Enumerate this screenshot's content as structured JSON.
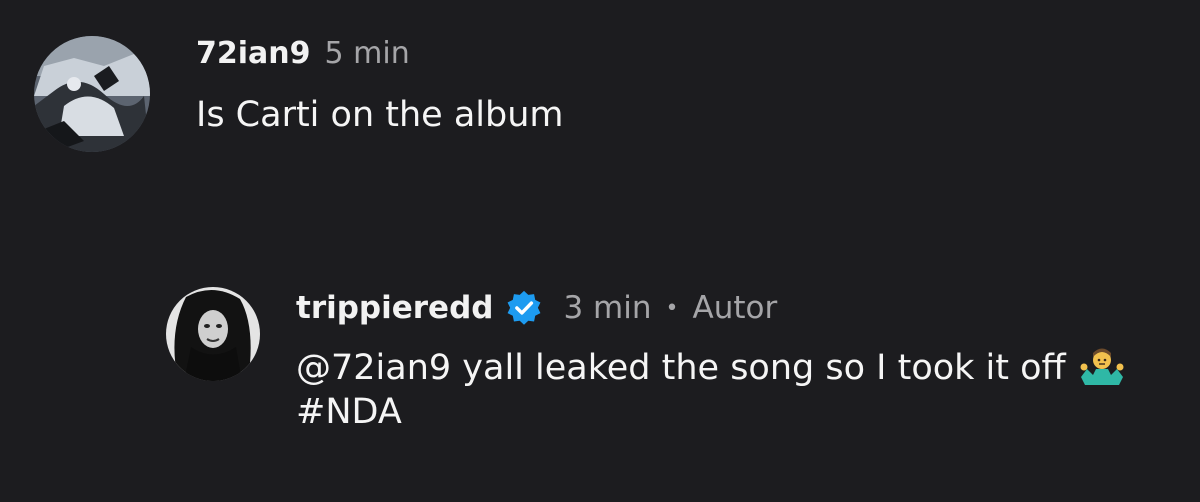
{
  "comments": [
    {
      "username": "72ian9",
      "time": "5 min",
      "text": "Is Carti on the album"
    },
    {
      "username": "trippieredd",
      "verified": true,
      "time": "3 min",
      "separator": "•",
      "author_tag": "Autor",
      "mention": "@72ian9",
      "text_line": " yall leaked the song so I took it off",
      "emoji": "person-shrugging",
      "hashtag": "#NDA"
    }
  ],
  "colors": {
    "background": "#1c1c1f",
    "primary_text": "#f5f5f5",
    "secondary_text": "#a5a5a8",
    "verified_badge": "#1d9bf0"
  }
}
